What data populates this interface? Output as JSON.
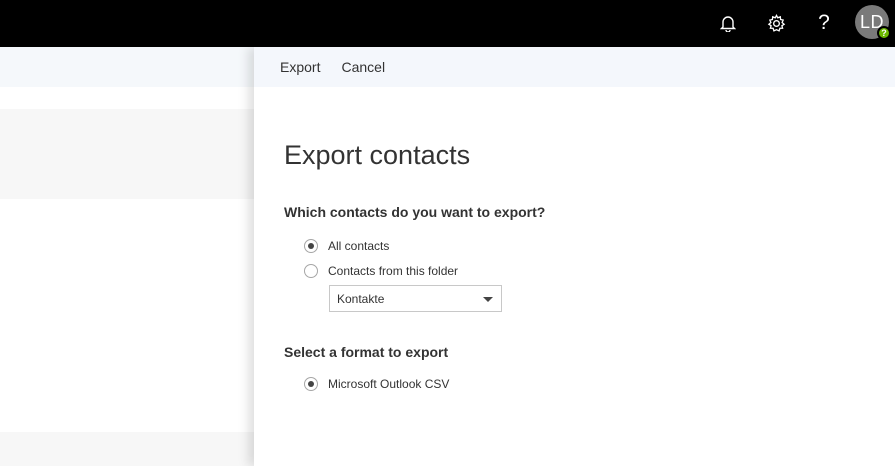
{
  "topbar": {
    "icons": [
      "bell-icon",
      "gear-icon",
      "help-icon"
    ],
    "help_glyph": "?",
    "avatar_initials": "LD",
    "presence_glyph": "?"
  },
  "commands": {
    "export_label": "Export",
    "cancel_label": "Cancel"
  },
  "panel": {
    "title": "Export contacts",
    "which_contacts_question": "Which contacts do you want to export?",
    "options": [
      {
        "label": "All contacts",
        "selected": true
      },
      {
        "label": "Contacts from this folder",
        "selected": false
      }
    ],
    "folder_select": {
      "value": "Kontakte"
    },
    "format_question": "Select a format to export",
    "format_option": {
      "label": "Microsoft Outlook CSV",
      "selected": true
    }
  },
  "colors": {
    "topbar": "#000000",
    "command_bar": "#f4f7fc",
    "presence": "#6bb700",
    "avatar": "#7a7a7a"
  }
}
